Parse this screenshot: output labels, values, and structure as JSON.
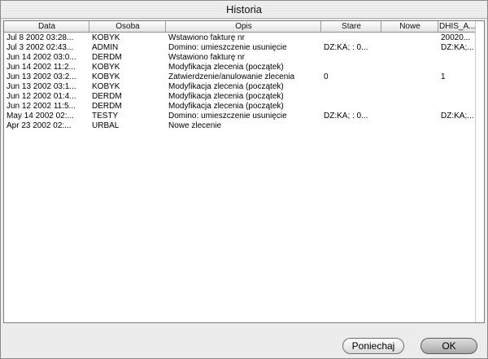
{
  "window": {
    "title": "Historia"
  },
  "table": {
    "columns": [
      "Data",
      "Osoba",
      "Opis",
      "Stare",
      "Nowe",
      "DHIS_A..."
    ],
    "rows": [
      [
        "Jul  8 2002 03:28...",
        "KOBYK",
        "Wstawiono fakturę nr",
        "",
        "",
        "20020..."
      ],
      [
        "Jul  3 2002 02:43...",
        "ADMIN",
        "Domino: umieszczenie usunięcie",
        "DZ:KA; : 0...",
        "",
        "DZ:KA;..."
      ],
      [
        "Jun 14 2002 03:0...",
        "DERDM",
        "Wstawiono fakturę nr",
        "",
        "",
        ""
      ],
      [
        "Jun 14 2002 11:2...",
        "KOBYK",
        "Modyfikacja zlecenia (początek)",
        "",
        "",
        ""
      ],
      [
        "Jun 13 2002 03:2...",
        "KOBYK",
        "Zatwierdzenie/anulowanie zlecenia",
        "0",
        "",
        "1"
      ],
      [
        "Jun 13 2002 03:1...",
        "KOBYK",
        "Modyfikacja zlecenia (początek)",
        "",
        "",
        ""
      ],
      [
        "Jun 12 2002 01:4...",
        "DERDM",
        "Modyfikacja zlecenia (początek)",
        "",
        "",
        ""
      ],
      [
        "Jun 12 2002 11:5...",
        "DERDM",
        "Modyfikacja zlecenia (początek)",
        "",
        "",
        ""
      ],
      [
        "May 14 2002 02:...",
        "TESTY",
        "Domino: umieszczenie usunięcie",
        "DZ:KA; : 0...",
        "",
        "DZ:KA;..."
      ],
      [
        "Apr 23 2002 02:...",
        "URBAL",
        "Nowe zlecenie",
        "",
        "",
        ""
      ]
    ]
  },
  "buttons": {
    "cancel": "Poniechaj",
    "ok": "OK"
  }
}
